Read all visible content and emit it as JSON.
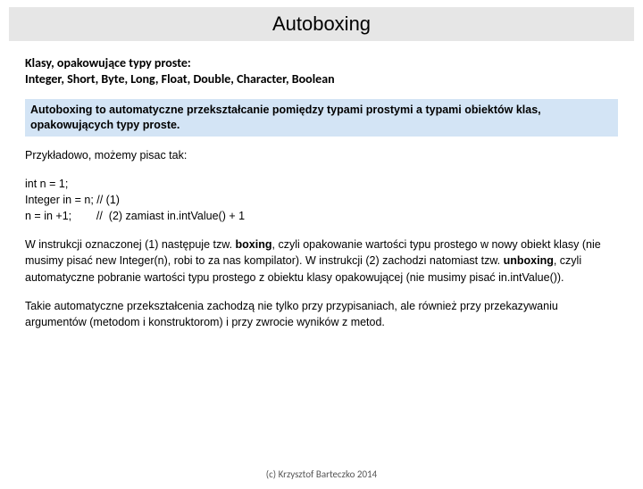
{
  "title": "Autoboxing",
  "intro": {
    "line1": "Klasy, opakowujące typy proste:",
    "line2": "Integer, Short, Byte, Long, Float, Double, Character, Boolean"
  },
  "highlight": "Autoboxing to automatyczne przekształcanie pomiędzy typami prostymi a typami obiektów klas, opakowujących typy proste.",
  "para1": "Przykładowo, możemy pisac tak:",
  "code": "int n = 1;\nInteger in = n; // (1)\nn = in +1;        //  (2) zamiast in.intValue() + 1",
  "para2_pre": "W instrukcji oznaczonej (1) następuje tzw. ",
  "para2_b1": "boxing",
  "para2_mid": ", czyli opakowanie wartości typu prostego w nowy obiekt klasy (nie musimy pisać new Integer(n), robi to za nas kompilator). W instrukcji (2) zachodzi natomiast tzw. ",
  "para2_b2": "unboxing",
  "para2_post": ", czyli automatyczne pobranie wartości typu prostego z obiektu klasy opakowującej (nie musimy pisać in.intValue()).",
  "para3": "Takie automatyczne przekształcenia zachodzą nie tylko przy przypisaniach, ale również przy przekazywaniu argumentów (metodom i konstruktorom) i  przy zwrocie wyników z metod.",
  "footer": "(c) Krzysztof Barteczko 2014"
}
